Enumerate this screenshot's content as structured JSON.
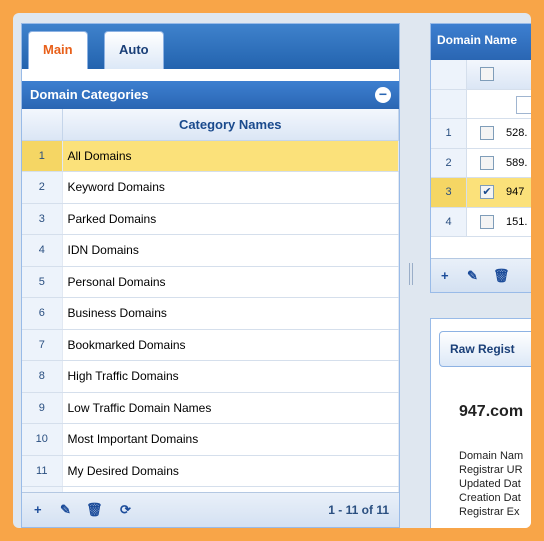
{
  "tabs": [
    {
      "label": "Main",
      "active": true
    },
    {
      "label": "Auto",
      "active": false
    }
  ],
  "categories_panel": {
    "title": "Domain Categories",
    "column_header": "Category Names",
    "rows": [
      {
        "num": "1",
        "name": "All Domains",
        "selected": true
      },
      {
        "num": "2",
        "name": "Keyword Domains"
      },
      {
        "num": "3",
        "name": "Parked Domains"
      },
      {
        "num": "4",
        "name": "IDN Domains"
      },
      {
        "num": "5",
        "name": "Personal Domains"
      },
      {
        "num": "6",
        "name": "Business Domains"
      },
      {
        "num": "7",
        "name": "Bookmarked Domains"
      },
      {
        "num": "8",
        "name": "High Traffic Domains"
      },
      {
        "num": "9",
        "name": "Low Traffic Domain Names"
      },
      {
        "num": "10",
        "name": "Most Important Domains"
      },
      {
        "num": "11",
        "name": "My Desired Domains"
      }
    ],
    "pager": "1 - 11 of 11"
  },
  "domain_names_panel": {
    "title": "Domain Name",
    "rows": [
      {
        "num": "1",
        "value": "528.",
        "checked": false
      },
      {
        "num": "2",
        "value": "589.",
        "checked": false
      },
      {
        "num": "3",
        "value": "947",
        "checked": true
      },
      {
        "num": "4",
        "value": "151.",
        "checked": false
      }
    ]
  },
  "registration_panel": {
    "tab_label": "Raw Regist",
    "domain": "947.com",
    "lines": [
      "Domain Nam",
      "Registrar UR",
      "Updated Dat",
      "Creation Dat",
      "Registrar Ex"
    ]
  },
  "colors": {
    "border_accent": "#f8a548",
    "header_blue": "#2a66b3",
    "selected_row": "#fbe17a",
    "active_tab_text": "#e8601a"
  }
}
